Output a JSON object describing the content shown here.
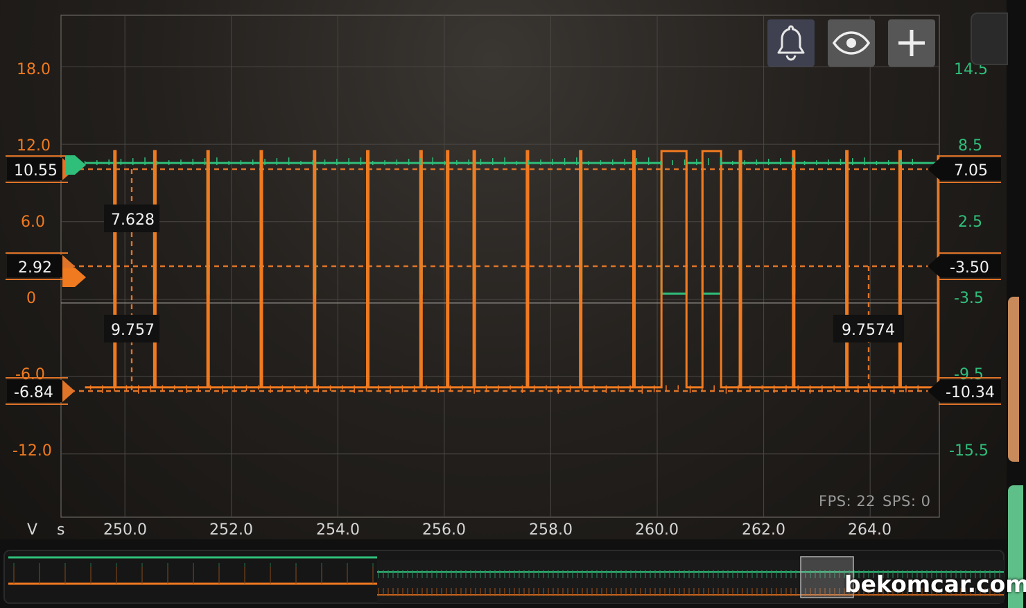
{
  "toolbar": {
    "alarm_icon": "bell-icon",
    "view_icon": "eye-icon",
    "add_icon": "plus-icon"
  },
  "colors": {
    "channel_a": "#f07a20",
    "channel_b": "#2fbf7a",
    "grid": "#5a5652",
    "cursor_bg": "#111111",
    "background": "#1e1b18"
  },
  "axis": {
    "left_unit": "V",
    "x_unit": "s",
    "left_ticks": [
      "18.0",
      "12.0",
      "6.0",
      "0",
      "-6.0",
      "-12.0"
    ],
    "right_ticks": [
      "14.5",
      "8.5",
      "2.5",
      "-3.5",
      "-9.5",
      "-15.5"
    ],
    "x_ticks": [
      "250.0",
      "252.0",
      "254.0",
      "256.0",
      "258.0",
      "260.0",
      "262.0",
      "264.0"
    ]
  },
  "markers": {
    "left": [
      "10.55",
      "2.92",
      "-6.84"
    ],
    "right": [
      "7.05",
      "-3.50",
      "-10.34"
    ]
  },
  "cursors": {
    "a_top": "7.628",
    "a_bottom": "9.757",
    "b_bottom": "9.7574"
  },
  "stats": {
    "fps": "FPS: 22",
    "sps": "SPS: 0"
  },
  "watermark": "bekomcar.com",
  "chart_data": {
    "type": "line",
    "xlabel": "s",
    "ylabel": "V",
    "xlim": [
      248.8,
      265.3
    ],
    "ylim_left": [
      -16.9,
      22.0
    ],
    "ylim_right": [
      -20.4,
      18.5
    ],
    "grid": true,
    "pulse_times": [
      249.8,
      250.55,
      251.55,
      252.55,
      253.55,
      254.55,
      255.55,
      256.05,
      256.55,
      257.55,
      258.55,
      259.55,
      261.55,
      262.55,
      263.55,
      264.55
    ],
    "burst_intervals": [
      [
        260.08,
        260.55
      ],
      [
        260.85,
        261.2
      ]
    ],
    "series": [
      {
        "axis": "right",
        "high": 7.05,
        "low": -3.5
      },
      {
        "axis": "left",
        "high": 9.757,
        "low": -6.84
      }
    ]
  }
}
